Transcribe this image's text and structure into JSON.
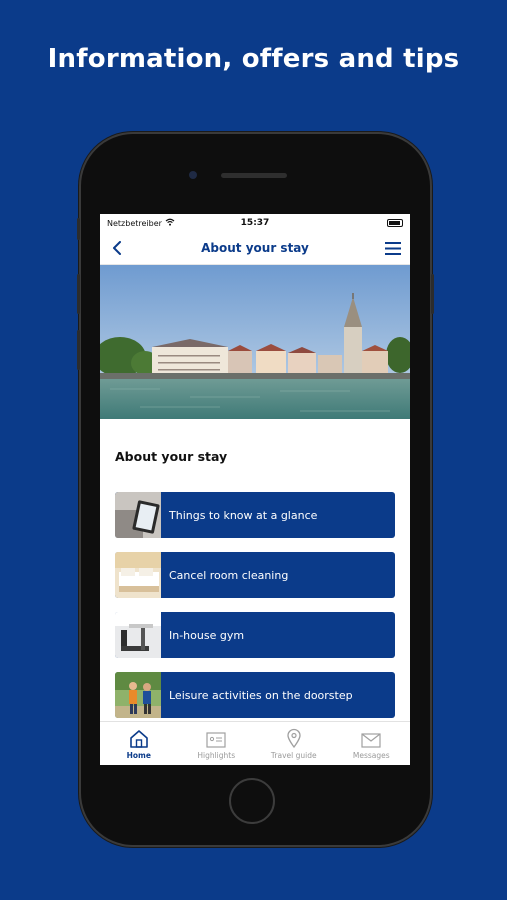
{
  "headline": "Information, offers and tips",
  "status_bar": {
    "carrier": "Netzbetreiber",
    "time": "15:37"
  },
  "nav": {
    "title": "About your stay",
    "back_icon": "chevron-left-icon",
    "menu_icon": "hamburger-menu-icon"
  },
  "page": {
    "section_title": "About your stay"
  },
  "cards": [
    {
      "label": "Things to know at a glance",
      "thumb": "tablet-photo"
    },
    {
      "label": "Cancel room cleaning",
      "thumb": "bed-photo"
    },
    {
      "label": "In-house gym",
      "thumb": "gym-photo"
    },
    {
      "label": "Leisure activities on the doorstep",
      "thumb": "people-outdoors-photo"
    }
  ],
  "tabs": [
    {
      "label": "Home",
      "icon": "home-icon",
      "active": true
    },
    {
      "label": "Highlights",
      "icon": "highlights-icon",
      "active": false
    },
    {
      "label": "Travel guide",
      "icon": "map-pin-icon",
      "active": false
    },
    {
      "label": "Messages",
      "icon": "envelope-icon",
      "active": false
    }
  ],
  "colors": {
    "brand": "#0b3b8a",
    "background": "#0b3b8a",
    "screen": "#ffffff"
  }
}
